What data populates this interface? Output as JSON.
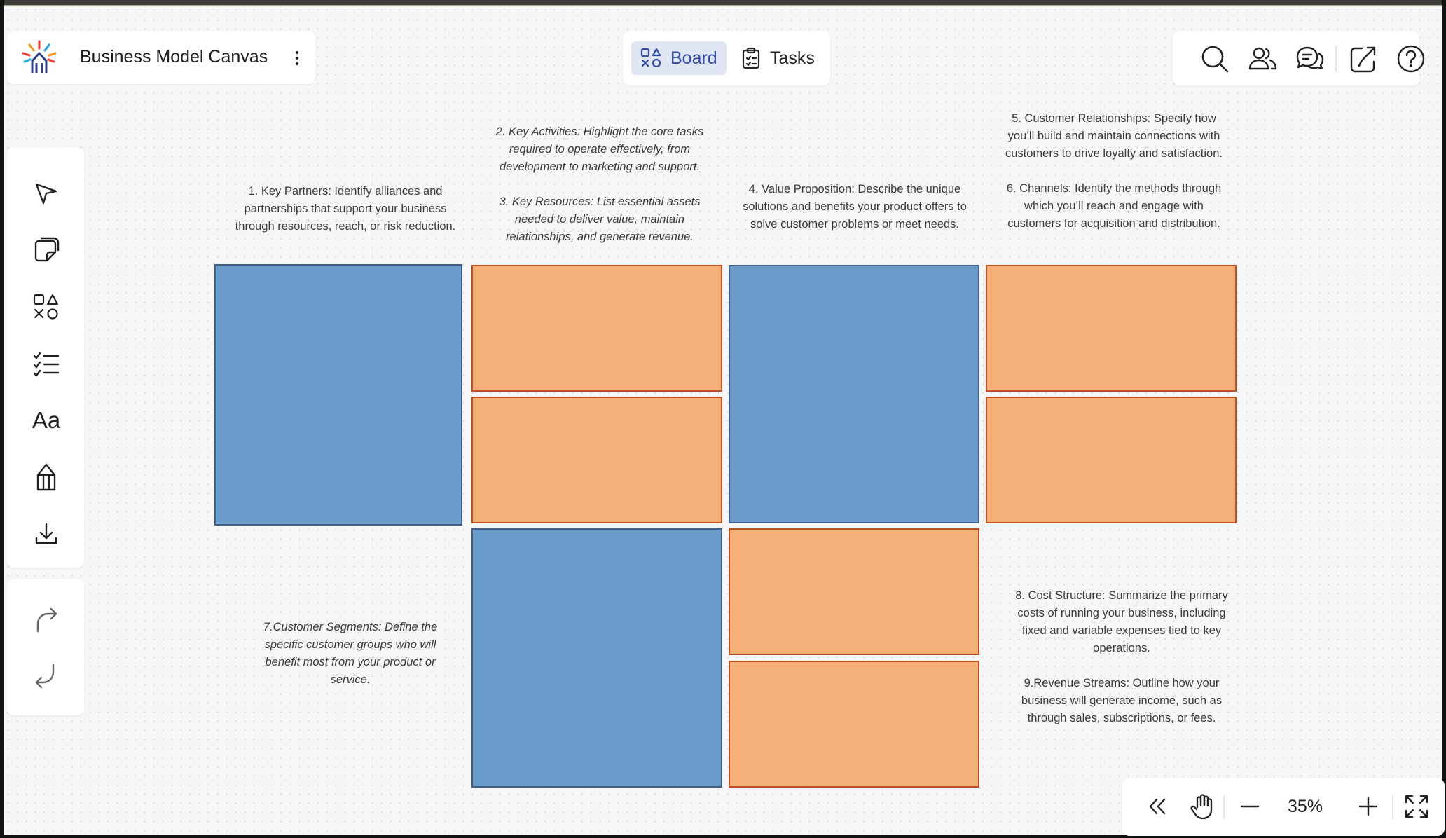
{
  "app": {
    "title": "Business Model Canvas"
  },
  "view_tabs": {
    "board": "Board",
    "tasks": "Tasks"
  },
  "header_actions": [
    "search-icon",
    "users-icon",
    "comments-icon",
    "share-icon",
    "help-icon"
  ],
  "toolbar": {
    "tools": [
      "pen-icon",
      "sticky-note-icon",
      "shapes-icon",
      "checklist-icon",
      "text-icon",
      "pencil-icon",
      "download-icon"
    ],
    "text_tool_label": "Aa",
    "history": [
      "redo-icon",
      "undo-icon"
    ]
  },
  "notes": {
    "key_partners": "1. Key Partners: Identify alliances and partnerships that support your business through resources, reach, or risk reduction.",
    "key_activities": "2. Key Activities: Highlight the core tasks required to operate effectively, from development to marketing and support.",
    "key_resources": "3. Key Resources: List essential assets needed to deliver value, maintain relationships, and generate revenue.",
    "value_proposition": "4. Value Proposition: Describe the unique solutions and benefits your product offers to solve customer problems or meet needs.",
    "customer_relationships": "5. Customer Relationships: Specify how you’ll build and maintain connections with customers to drive loyalty and satisfaction.",
    "channels": "6. Channels: Identify the methods through which you’ll reach and engage with customers for acquisition and distribution.",
    "customer_segments": "7.Customer Segments: Define the specific customer groups who will benefit most from your product or service.",
    "cost_structure": "8. Cost Structure: Summarize the primary costs of running your business, including fixed and variable expenses tied to key operations.",
    "revenue_streams": "9.Revenue Streams: Outline how your business will generate income, such as through sales, subscriptions, or fees."
  },
  "colors": {
    "blue_block": "#6a9bca",
    "orange_block": "#f5b07a",
    "accent": "#2d4aa4"
  },
  "zoom": {
    "level": "35%"
  }
}
